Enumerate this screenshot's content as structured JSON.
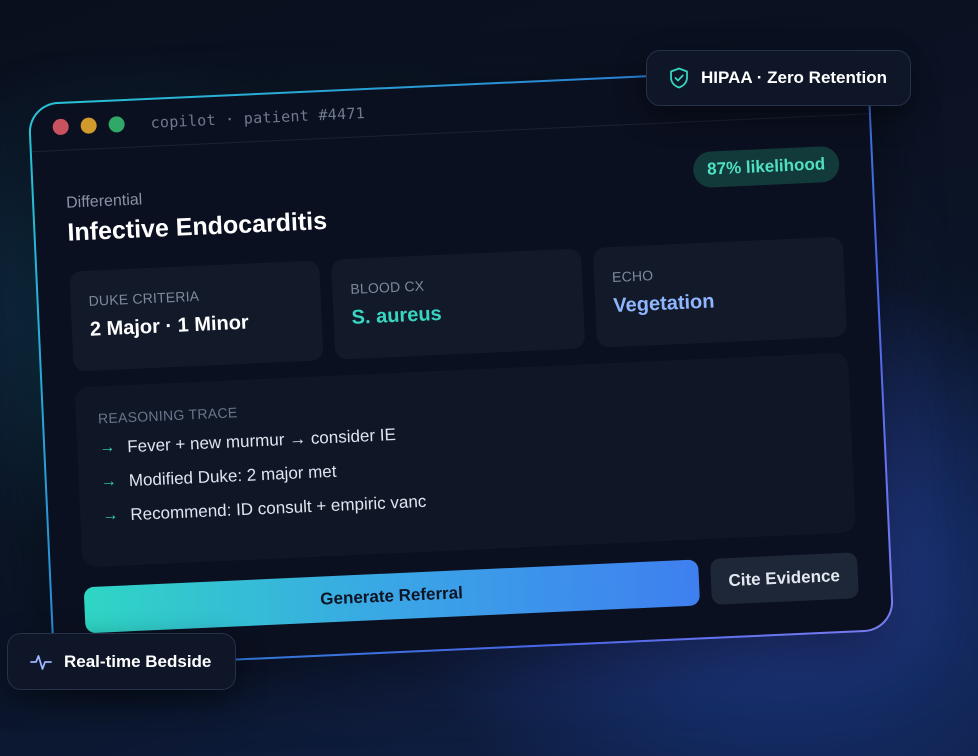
{
  "window": {
    "title": "copilot · patient #4471"
  },
  "result": {
    "label": "Differential",
    "diagnosis": "Infective Endocarditis",
    "likelihood": "87% likelihood"
  },
  "cards": [
    {
      "label": "DUKE CRITERIA",
      "value": "2 Major · 1 Minor"
    },
    {
      "label": "BLOOD CX",
      "value": "S. aureus"
    },
    {
      "label": "ECHO",
      "value": "Vegetation"
    }
  ],
  "trace": {
    "title": "REASONING TRACE",
    "lines": [
      "Fever + new murmur → consider IE",
      "Modified Duke: 2 major met",
      "Recommend: ID consult + empiric vanc"
    ],
    "arrow": "→"
  },
  "actions": {
    "primary": "Generate Referral",
    "secondary": "Cite Evidence"
  },
  "badges": {
    "top": {
      "label": "HIPAA · Zero Retention",
      "icon": "shield-check-icon"
    },
    "bottom": {
      "label": "Real-time Bedside",
      "icon": "pulse-icon"
    }
  },
  "colors": {
    "accent_teal": "#38d6c0",
    "accent_blue": "#3f7ff0",
    "window_bg": "#0b1020"
  }
}
